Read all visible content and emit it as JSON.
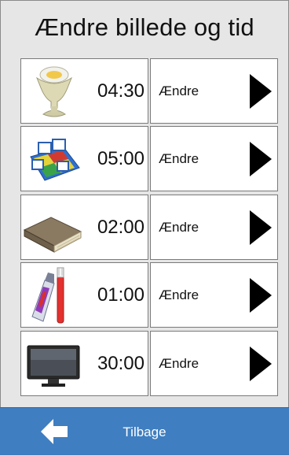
{
  "header": {
    "title": "Ændre billede og tid"
  },
  "rows": [
    {
      "icon": "egg-cup-icon",
      "time": "04:30",
      "action_label": "Ændre"
    },
    {
      "icon": "ludo-board-game-icon",
      "time": "05:00",
      "action_label": "Ændre"
    },
    {
      "icon": "book-icon",
      "time": "02:00",
      "action_label": "Ændre"
    },
    {
      "icon": "toothbrush-toothpaste-icon",
      "time": "01:00",
      "action_label": "Ændre"
    },
    {
      "icon": "television-icon",
      "time": "30:00",
      "action_label": "Ændre"
    }
  ],
  "footer": {
    "back_label": "Tilbage",
    "icon": "back-arrow-icon"
  },
  "colors": {
    "footer_bg": "#3f7ec0",
    "background": "#e6e6e6"
  }
}
